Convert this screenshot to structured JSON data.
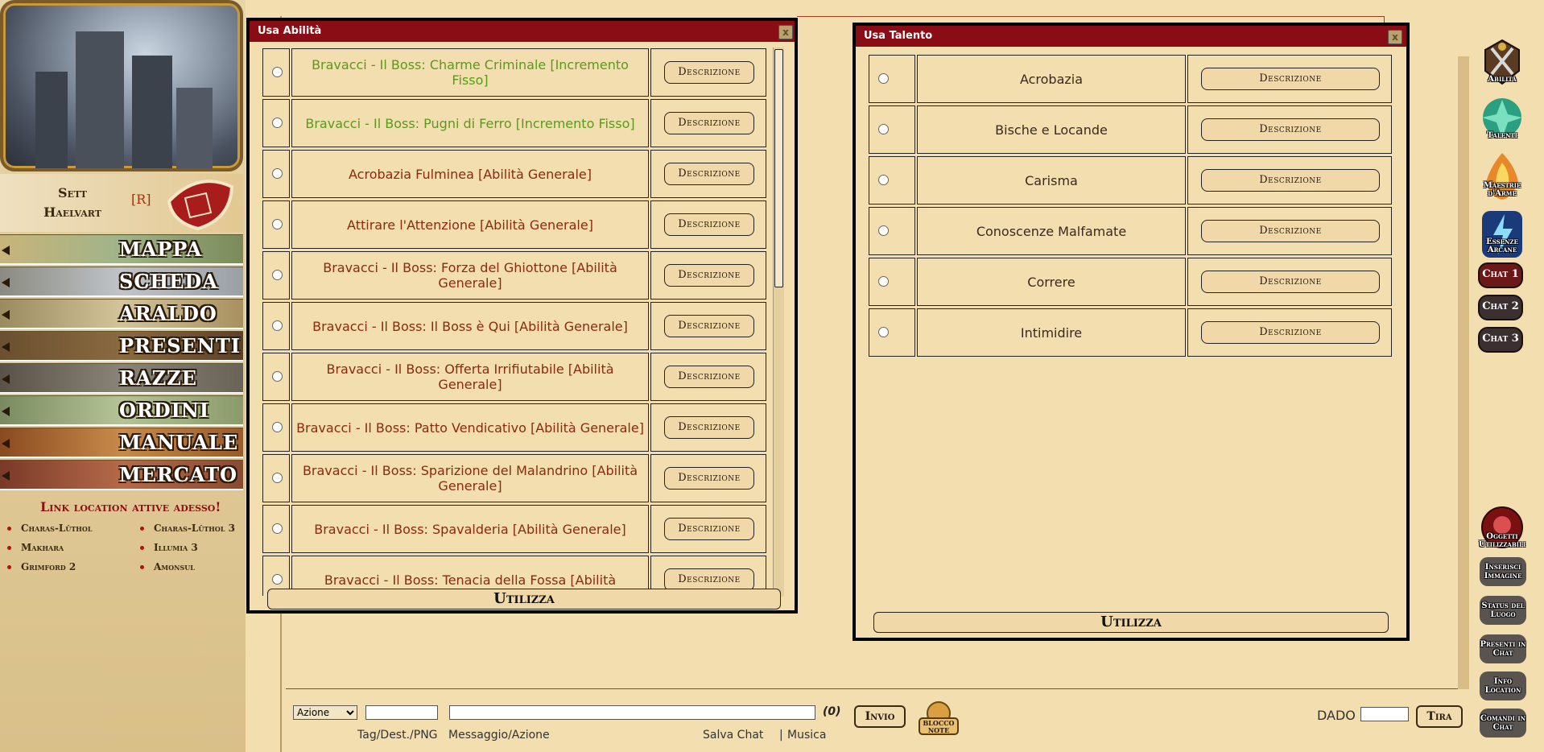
{
  "character": {
    "name_line1": "Sett",
    "name_line2": "Haelvart",
    "role": "[R]"
  },
  "nav": [
    {
      "label": "MAPPA"
    },
    {
      "label": "SCHEDA"
    },
    {
      "label": "ARALDO"
    },
    {
      "label": "PRESENTI"
    },
    {
      "label": "RAZZE"
    },
    {
      "label": "ORDINI"
    },
    {
      "label": "MANUALE"
    },
    {
      "label": "MERCATO"
    }
  ],
  "active_locations": {
    "title": "Link location attive adesso!",
    "items": [
      "Charas-Lûthol",
      "Makhara",
      "Grimford 2",
      "Charas-Lûthol 3",
      "Illumia 3",
      "Amonsul"
    ]
  },
  "abilita_dialog": {
    "title": "Usa Abilità",
    "close": "x",
    "desc_label": "Descrizione",
    "use_label": "Utilizza",
    "items": [
      {
        "name": "Bravacci - Il Boss: Charme Criminale [Incremento Fisso]",
        "color": "#5a9a1a"
      },
      {
        "name": "Bravacci - Il Boss: Pugni di Ferro [Incremento Fisso]",
        "color": "#5a9a1a"
      },
      {
        "name": "Acrobazia Fulminea [Abilità Generale]",
        "color": "#8a2a10"
      },
      {
        "name": "Attirare l'Attenzione [Abilità Generale]",
        "color": "#8a2a10"
      },
      {
        "name": "Bravacci - Il Boss: Forza del Ghiottone [Abilità Generale]",
        "color": "#8a2a10"
      },
      {
        "name": "Bravacci - Il Boss: Il Boss è Qui [Abilità Generale]",
        "color": "#8a2a10"
      },
      {
        "name": "Bravacci - Il Boss: Offerta Irrifiutabile [Abilità Generale]",
        "color": "#8a2a10"
      },
      {
        "name": "Bravacci - Il Boss: Patto Vendicativo [Abilità Generale]",
        "color": "#8a2a10"
      },
      {
        "name": "Bravacci - Il Boss: Sparizione del Malandrino [Abilità Generale]",
        "color": "#8a2a10"
      },
      {
        "name": "Bravacci - Il Boss: Spavalderia [Abilità Generale]",
        "color": "#8a2a10"
      },
      {
        "name": "Bravacci - Il Boss: Tenacia della Fossa [Abilità",
        "color": "#8a2a10"
      }
    ]
  },
  "talento_dialog": {
    "title": "Usa Talento",
    "close": "x",
    "desc_label": "Descrizione",
    "use_label": "Utilizza",
    "items": [
      {
        "name": "Acrobazia"
      },
      {
        "name": "Bische e Locande"
      },
      {
        "name": "Carisma"
      },
      {
        "name": "Conoscenze Malfamate"
      },
      {
        "name": "Correre"
      },
      {
        "name": "Intimidire"
      }
    ]
  },
  "chat_bar": {
    "action_select": "Azione",
    "char_count": "(0)",
    "send": "Invio",
    "notes": "Blocco Note",
    "tag_label": "Tag/Dest./PNG",
    "msg_label": "Messaggio/Azione",
    "save_chat": "Salva Chat",
    "separator": "|",
    "music": "Musica",
    "dice_label": "DADO",
    "roll": "Tira"
  },
  "right_icons": {
    "abilita": "Abilità",
    "talenti": "Talenti",
    "maestrie": "Maestrie d'Arme",
    "essenze": "Essenze Arcane",
    "chat1": "Chat 1",
    "chat2": "Chat 2",
    "chat3": "Chat 3",
    "oggetti": "Oggetti Utilizzabili",
    "inserisci": "Inserisci Immagine",
    "status": "Status del Luogo",
    "presenti": "Presenti in Chat",
    "info": "Info Location",
    "comandi": "Comandi in Chat"
  },
  "colors": {
    "dialog_header": "#8a0c14",
    "bg": "#f3deb0",
    "green_item": "#5a9a1a",
    "red_item": "#8a2a10"
  }
}
